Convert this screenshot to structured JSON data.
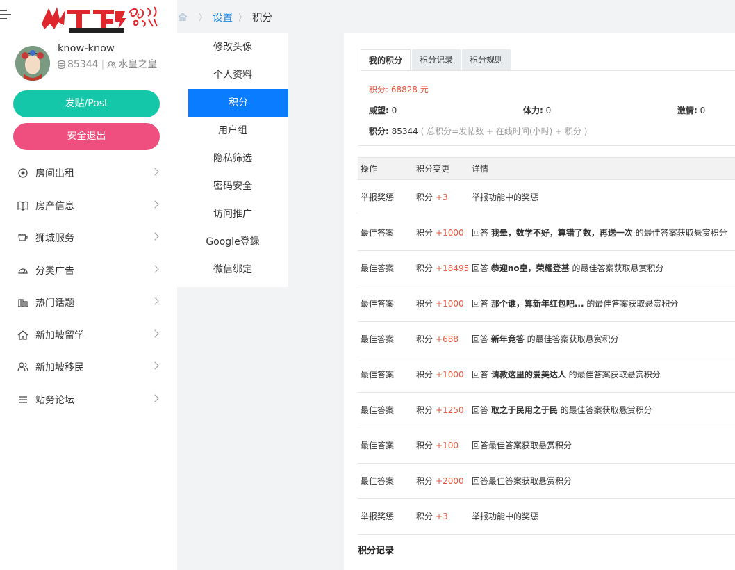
{
  "sidebar": {
    "logo_text": "狮城论坛 BBS.SGCN.COM SGCN .COM",
    "user": {
      "name": "know-know",
      "points": "85344",
      "group": "水皇之皇"
    },
    "post_button": "发贴/Post",
    "logout_button": "安全退出",
    "nav": [
      {
        "label": "房间出租",
        "icon": "target-icon"
      },
      {
        "label": "房产信息",
        "icon": "book-icon"
      },
      {
        "label": "狮城服务",
        "icon": "service-icon"
      },
      {
        "label": "分类广告",
        "icon": "dashboard-icon"
      },
      {
        "label": "热门话题",
        "icon": "building-icon"
      },
      {
        "label": "新加坡留学",
        "icon": "home-icon"
      },
      {
        "label": "新加坡移民",
        "icon": "users-icon"
      },
      {
        "label": "站务论坛",
        "icon": "list-icon"
      }
    ]
  },
  "breadcrumb": {
    "settings": "设置",
    "current": "积分"
  },
  "settings_menu": [
    {
      "label": "修改头像",
      "active": false
    },
    {
      "label": "个人资料",
      "active": false
    },
    {
      "label": "积分",
      "active": true
    },
    {
      "label": "用户组",
      "active": false
    },
    {
      "label": "隐私筛选",
      "active": false
    },
    {
      "label": "密码安全",
      "active": false
    },
    {
      "label": "访问推广",
      "active": false
    },
    {
      "label": "Google登録",
      "active": false
    },
    {
      "label": "微信绑定",
      "active": false
    }
  ],
  "tabs": [
    "我的积分",
    "积分记录",
    "积分规则"
  ],
  "summary": {
    "total": "积分: 68828 元",
    "weili_label": "威望:",
    "weili_value": "0",
    "tili_label": "体力:",
    "tili_value": "0",
    "jiqing_label": "激情:",
    "jiqing_value": "0",
    "points_label": "积分:",
    "points_value": "85344",
    "formula": "( 总积分=发帖数 + 在线时间(小时) + 积分 )"
  },
  "table": {
    "headers": [
      "操作",
      "积分变更",
      "详情"
    ],
    "rows": [
      {
        "op": "举报奖惩",
        "unit": "积分",
        "change": "+3",
        "pre": "举报功能中的奖惩",
        "bold": "",
        "post": ""
      },
      {
        "op": "最佳答案",
        "unit": "积分",
        "change": "+1000",
        "pre": "回答 ",
        "bold": "我晕，数学不好，算错了数，再送一次",
        "post": " 的最佳答案获取悬赏积分"
      },
      {
        "op": "最佳答案",
        "unit": "积分",
        "change": "+18495",
        "pre": "回答 ",
        "bold": "恭迎no皇，荣耀登基",
        "post": " 的最佳答案获取悬赏积分"
      },
      {
        "op": "最佳答案",
        "unit": "积分",
        "change": "+1000",
        "pre": "回答 ",
        "bold": "那个谁，算新年红包吧...",
        "post": " 的最佳答案获取悬赏积分"
      },
      {
        "op": "最佳答案",
        "unit": "积分",
        "change": "+688",
        "pre": "回答 ",
        "bold": "新年竞答",
        "post": " 的最佳答案获取悬赏积分"
      },
      {
        "op": "最佳答案",
        "unit": "积分",
        "change": "+1000",
        "pre": "回答 ",
        "bold": "请教这里的爱美达人",
        "post": " 的最佳答案获取悬赏积分"
      },
      {
        "op": "最佳答案",
        "unit": "积分",
        "change": "+1250",
        "pre": "回答 ",
        "bold": "取之于民用之于民",
        "post": " 的最佳答案获取悬赏积分"
      },
      {
        "op": "最佳答案",
        "unit": "积分",
        "change": "+100",
        "pre": "回答最佳答案获取悬赏积分",
        "bold": "",
        "post": ""
      },
      {
        "op": "最佳答案",
        "unit": "积分",
        "change": "+2000",
        "pre": "回答最佳答案获取悬赏积分",
        "bold": "",
        "post": ""
      },
      {
        "op": "举报奖惩",
        "unit": "积分",
        "change": "+3",
        "pre": "举报功能中的奖惩",
        "bold": "",
        "post": ""
      }
    ]
  },
  "footer_title": "积分记录",
  "colors": {
    "post_button": "#13c7a8",
    "logout_button": "#ef4f7e",
    "active_menu": "#0a7cff",
    "points_accent": "#e8583e",
    "link": "#1e88e5"
  }
}
